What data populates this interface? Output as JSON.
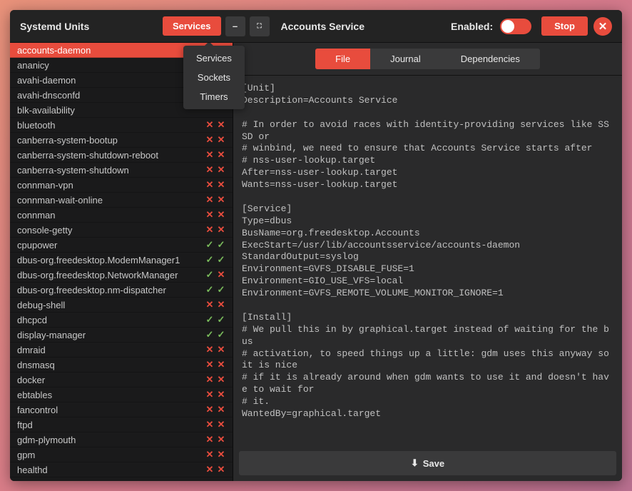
{
  "header": {
    "title": "Systemd Units",
    "units_button": "Services",
    "service_name": "Accounts Service",
    "enabled_label": "Enabled:",
    "stop_label": "Stop"
  },
  "dropdown": {
    "items": [
      "Services",
      "Sockets",
      "Timers"
    ]
  },
  "units": [
    {
      "name": "accounts-daemon",
      "enabled": true,
      "active": true,
      "selected": true
    },
    {
      "name": "ananicy",
      "enabled": null,
      "active": null
    },
    {
      "name": "avahi-daemon",
      "enabled": null,
      "active": null
    },
    {
      "name": "avahi-dnsconfd",
      "enabled": null,
      "active": null
    },
    {
      "name": "blk-availability",
      "enabled": null,
      "active": null
    },
    {
      "name": "bluetooth",
      "enabled": false,
      "active": false
    },
    {
      "name": "canberra-system-bootup",
      "enabled": false,
      "active": false
    },
    {
      "name": "canberra-system-shutdown-reboot",
      "enabled": false,
      "active": false
    },
    {
      "name": "canberra-system-shutdown",
      "enabled": false,
      "active": false
    },
    {
      "name": "connman-vpn",
      "enabled": false,
      "active": false
    },
    {
      "name": "connman-wait-online",
      "enabled": false,
      "active": false
    },
    {
      "name": "connman",
      "enabled": false,
      "active": false
    },
    {
      "name": "console-getty",
      "enabled": false,
      "active": false
    },
    {
      "name": "cpupower",
      "enabled": true,
      "active": true
    },
    {
      "name": "dbus-org.freedesktop.ModemManager1",
      "enabled": true,
      "active": true
    },
    {
      "name": "dbus-org.freedesktop.NetworkManager",
      "enabled": true,
      "active": false
    },
    {
      "name": "dbus-org.freedesktop.nm-dispatcher",
      "enabled": true,
      "active": true
    },
    {
      "name": "debug-shell",
      "enabled": false,
      "active": false
    },
    {
      "name": "dhcpcd",
      "enabled": true,
      "active": true
    },
    {
      "name": "display-manager",
      "enabled": true,
      "active": true
    },
    {
      "name": "dmraid",
      "enabled": false,
      "active": false
    },
    {
      "name": "dnsmasq",
      "enabled": false,
      "active": false
    },
    {
      "name": "docker",
      "enabled": false,
      "active": false
    },
    {
      "name": "ebtables",
      "enabled": false,
      "active": false
    },
    {
      "name": "fancontrol",
      "enabled": false,
      "active": false
    },
    {
      "name": "ftpd",
      "enabled": false,
      "active": false
    },
    {
      "name": "gdm-plymouth",
      "enabled": false,
      "active": false
    },
    {
      "name": "gpm",
      "enabled": false,
      "active": false
    },
    {
      "name": "healthd",
      "enabled": false,
      "active": false
    }
  ],
  "tabs": {
    "items": [
      "File",
      "Journal",
      "Dependencies"
    ],
    "active": 0
  },
  "file_content": "[Unit]\nDescription=Accounts Service\n\n# In order to avoid races with identity-providing services like SSSD or\n# winbind, we need to ensure that Accounts Service starts after\n# nss-user-lookup.target\nAfter=nss-user-lookup.target\nWants=nss-user-lookup.target\n\n[Service]\nType=dbus\nBusName=org.freedesktop.Accounts\nExecStart=/usr/lib/accountsservice/accounts-daemon\nStandardOutput=syslog\nEnvironment=GVFS_DISABLE_FUSE=1\nEnvironment=GIO_USE_VFS=local\nEnvironment=GVFS_REMOTE_VOLUME_MONITOR_IGNORE=1\n\n[Install]\n# We pull this in by graphical.target instead of waiting for the bus\n# activation, to speed things up a little: gdm uses this anyway so it is nice\n# if it is already around when gdm wants to use it and doesn't have to wait for\n# it.\nWantedBy=graphical.target",
  "save_label": "Save",
  "icons": {
    "minimize": "–",
    "maximize": "⛶",
    "close": "✕",
    "check": "✓",
    "cross": "✕",
    "download": "⬇"
  }
}
